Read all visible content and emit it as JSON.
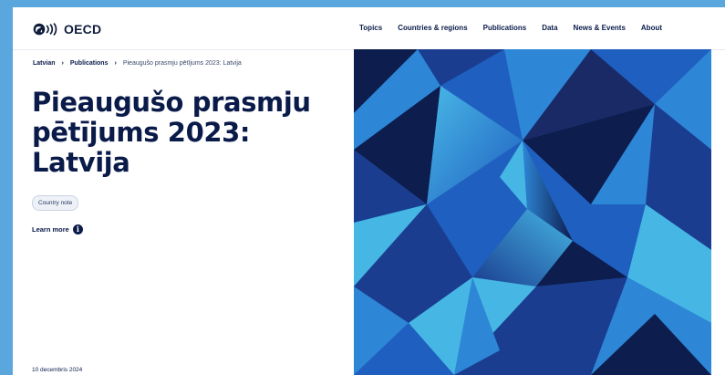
{
  "header": {
    "logo_text": "OECD",
    "nav": [
      "Topics",
      "Countries & regions",
      "Publications",
      "Data",
      "News & Events",
      "About"
    ]
  },
  "breadcrumb": {
    "items": [
      "Latvian",
      "Publications"
    ],
    "current": "Pieaugušo prasmju pētījums 2023: Latvija"
  },
  "publication": {
    "title": "Pieaugušo prasmju pētījums 2023: Latvija",
    "type_badge": "Country note",
    "learn_more": "Learn more",
    "date": "10 decembris 2024"
  },
  "colors": {
    "background": "#5aa7de",
    "navy": "#0a1b4a",
    "hero_palette": [
      "#0d1d4d",
      "#1a3d8f",
      "#1f5fc0",
      "#2d86d6",
      "#46b6e4",
      "#1a2a66"
    ]
  },
  "icons": {
    "logo": "oecd-logo-icon",
    "breadcrumb_separator": "chevron-right-icon",
    "learn_more": "info-icon"
  }
}
